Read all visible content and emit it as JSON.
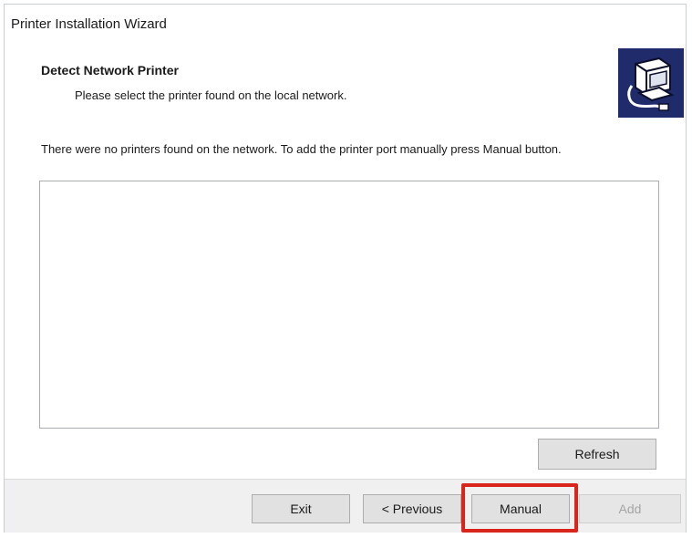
{
  "window": {
    "title": "Printer Installation Wizard"
  },
  "header": {
    "title": "Detect Network Printer",
    "subtitle": "Please select the printer found on the local network.",
    "icon": "printer-network-icon"
  },
  "main": {
    "message": "There were no printers found on the network. To add the printer port manually press Manual button.",
    "printer_list": [],
    "refresh_label": "Refresh"
  },
  "footer": {
    "exit_label": "Exit",
    "previous_label": "< Previous",
    "manual_label": "Manual",
    "add_label": "Add"
  },
  "colors": {
    "icon_background": "#1f2b6b",
    "highlight": "#d9251c"
  }
}
